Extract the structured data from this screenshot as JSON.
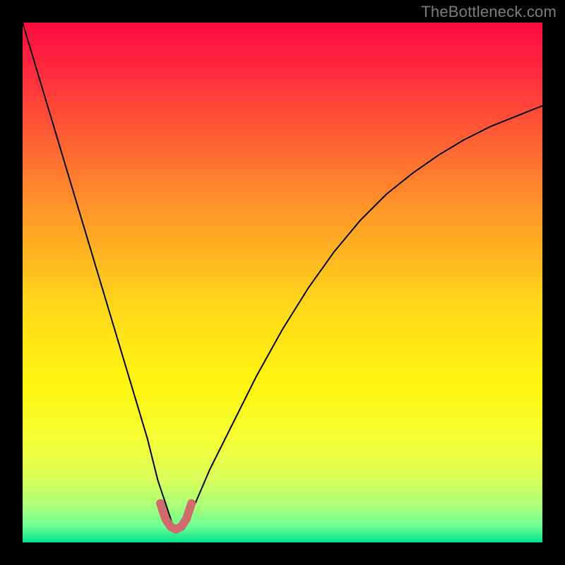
{
  "watermark": "TheBottleneck.com",
  "chart_data": {
    "type": "line",
    "title": "",
    "xlabel": "",
    "ylabel": "",
    "xlim": [
      0,
      100
    ],
    "ylim": [
      0,
      100
    ],
    "grid": false,
    "legend": false,
    "background_gradient_stops": [
      {
        "offset": 0.0,
        "color": "#ff0b3e"
      },
      {
        "offset": 0.1,
        "color": "#ff2d3d"
      },
      {
        "offset": 0.25,
        "color": "#ff6b32"
      },
      {
        "offset": 0.4,
        "color": "#ffa525"
      },
      {
        "offset": 0.55,
        "color": "#ffd91a"
      },
      {
        "offset": 0.7,
        "color": "#fff60f"
      },
      {
        "offset": 0.8,
        "color": "#f7ff36"
      },
      {
        "offset": 0.88,
        "color": "#d9ff5a"
      },
      {
        "offset": 0.93,
        "color": "#aaff7a"
      },
      {
        "offset": 0.97,
        "color": "#6cff95"
      },
      {
        "offset": 1.0,
        "color": "#00e18a"
      }
    ],
    "series": [
      {
        "name": "bottleneck-curve",
        "color": "#000000",
        "width": 2,
        "x": [
          0,
          3,
          6,
          9,
          12,
          15,
          18,
          21,
          24,
          26,
          28,
          29,
          30,
          31,
          33,
          36,
          40,
          45,
          50,
          55,
          60,
          65,
          70,
          75,
          80,
          85,
          90,
          95,
          100
        ],
        "values": [
          100,
          90,
          80,
          70,
          60,
          50,
          40,
          30,
          20,
          12,
          6,
          3,
          2,
          3,
          7,
          14,
          22,
          32,
          41,
          49,
          56,
          62,
          67,
          71,
          74.5,
          77.5,
          80,
          82,
          84
        ]
      }
    ],
    "highlight_segment": {
      "name": "near-zero-bottleneck",
      "color": "#d16a6a",
      "width": 12,
      "x": [
        26.5,
        27.5,
        28.5,
        29.5,
        30.5,
        31.5,
        32.5
      ],
      "values": [
        7.5,
        4.5,
        3.0,
        2.5,
        3.0,
        4.5,
        7.5
      ]
    }
  }
}
